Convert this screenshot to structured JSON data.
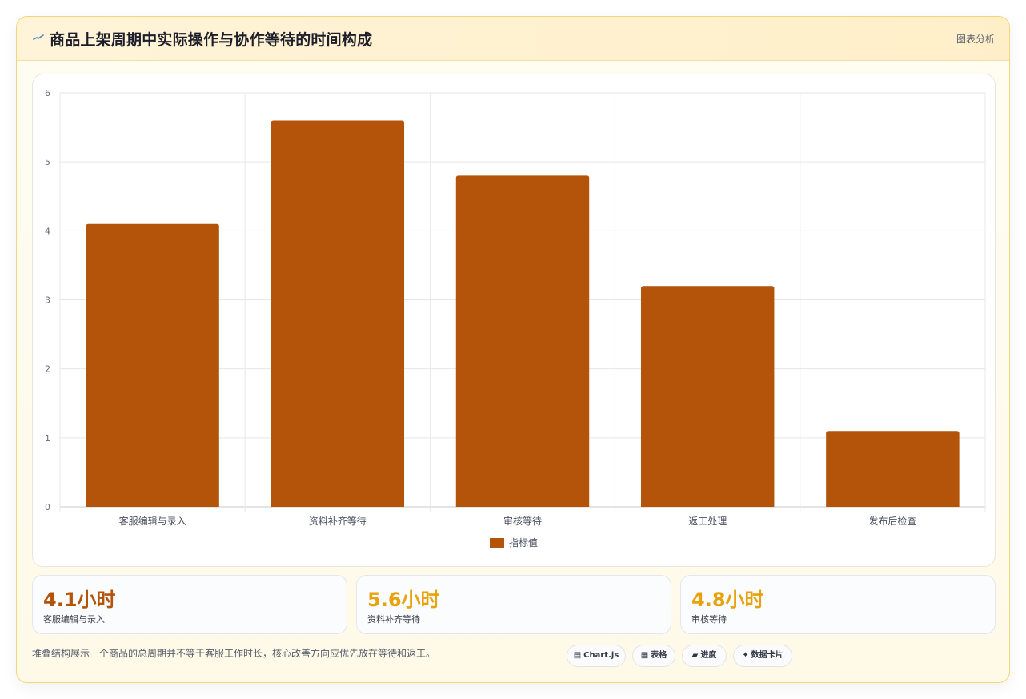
{
  "header": {
    "title": "商品上架周期中实际操作与协作等待的时间构成",
    "tag": "图表分析",
    "icon": "pulse-line-icon"
  },
  "chart_data": {
    "type": "bar",
    "categories": [
      "客服编辑与录入",
      "资料补齐等待",
      "审核等待",
      "返工处理",
      "发布后检查"
    ],
    "series": [
      {
        "name": "指标值",
        "values": [
          4.1,
          5.6,
          4.8,
          3.2,
          1.1
        ],
        "color": "#b4540a"
      }
    ],
    "title": "",
    "xlabel": "",
    "ylabel": "",
    "ylim": [
      0,
      6
    ],
    "yticks": [
      "0",
      "1",
      "2",
      "3",
      "4",
      "5",
      "6"
    ],
    "grid": true,
    "legend_position": "bottom"
  },
  "stats": [
    {
      "value": "4.1小时",
      "label": "客服编辑与录入",
      "color": "#b4540a"
    },
    {
      "value": "5.6小时",
      "label": "资料补齐等待",
      "color": "#e8a20c"
    },
    {
      "value": "4.8小时",
      "label": "审核等待",
      "color": "#e8a20c"
    }
  ],
  "footer": {
    "note": "堆叠结构展示一个商品的总周期并不等于客服工作时长，核心改善方向应优先放在等待和返工。"
  },
  "chips": [
    {
      "icon": "chart-icon",
      "glyph": "▤",
      "label": "Chart.js"
    },
    {
      "icon": "table-icon",
      "glyph": "▦",
      "label": "表格"
    },
    {
      "icon": "progress-icon",
      "glyph": "▰",
      "label": "进度"
    },
    {
      "icon": "sparkle-icon",
      "glyph": "✦",
      "label": "数据卡片"
    }
  ]
}
